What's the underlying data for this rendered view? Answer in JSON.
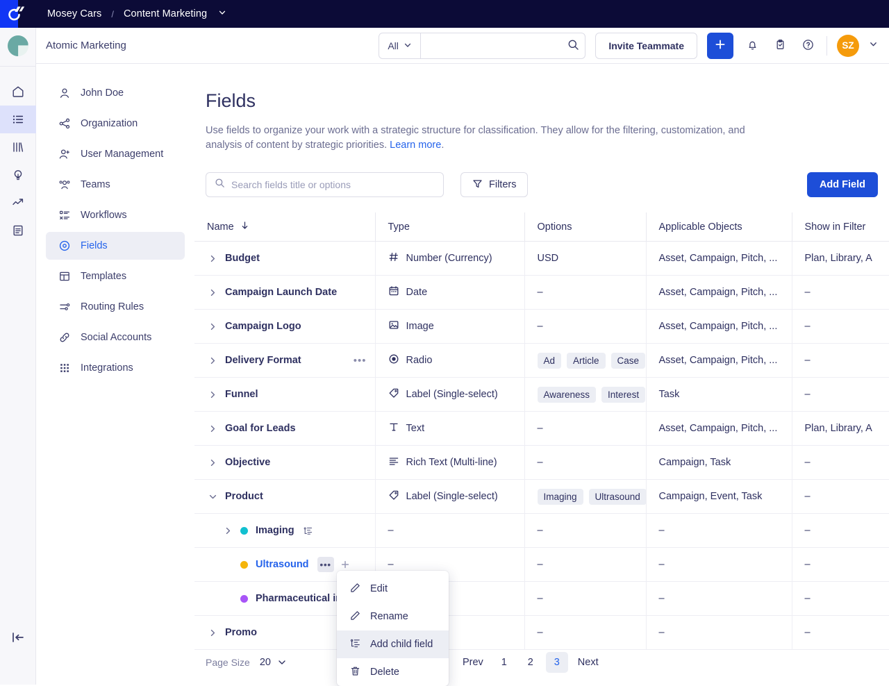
{
  "topbar": {
    "logo_icon": "mosey-logo-icon",
    "breadcrumb_workspace": "Mosey Cars",
    "breadcrumb_separator": "/",
    "breadcrumb_space": "Content Marketing",
    "breadcrumb_caret_icon": "chevron-down-icon"
  },
  "header": {
    "org_name": "Atomic Marketing",
    "search_scope": "All",
    "search_value": "",
    "search_placeholder": "",
    "search_icon": "search-icon",
    "invite_label": "Invite Teammate",
    "plus_icon": "plus-icon",
    "bell_icon": "bell-icon",
    "clipboard_icon": "clipboard-check-icon",
    "help_icon": "question-circle-icon",
    "avatar_initials": "SZ",
    "avatar_caret_icon": "chevron-down-icon",
    "avatar_color": "#f59b0b",
    "accent_color": "#1d4ed8"
  },
  "rail": {
    "brand_avatar": "workspace-avatar",
    "items": [
      {
        "icon": "home-icon",
        "name": "rail-item-home",
        "active": false
      },
      {
        "icon": "list-icon",
        "name": "rail-item-list",
        "active": true
      },
      {
        "icon": "columns-icon",
        "name": "rail-item-columns",
        "active": false
      },
      {
        "icon": "lightbulb-icon",
        "name": "rail-item-ideas",
        "active": false
      },
      {
        "icon": "trend-up-icon",
        "name": "rail-item-analytics",
        "active": false
      },
      {
        "icon": "document-icon",
        "name": "rail-item-reports",
        "active": false
      }
    ],
    "collapse_icon": "collapse-sidebar-icon"
  },
  "sidebar": {
    "items": [
      {
        "label": "John Doe",
        "icon": "user-icon",
        "active": false
      },
      {
        "label": "Organization",
        "icon": "share-nodes-icon",
        "active": false
      },
      {
        "label": "User Management",
        "icon": "user-plus-icon",
        "active": false
      },
      {
        "label": "Teams",
        "icon": "users-group-icon",
        "active": false
      },
      {
        "label": "Workflows",
        "icon": "workflow-icon",
        "active": false
      },
      {
        "label": "Fields",
        "icon": "target-circle-icon",
        "active": true
      },
      {
        "label": "Templates",
        "icon": "layout-icon",
        "active": false
      },
      {
        "label": "Routing Rules",
        "icon": "sliders-icon",
        "active": false
      },
      {
        "label": "Social Accounts",
        "icon": "link-icon",
        "active": false
      },
      {
        "label": "Integrations",
        "icon": "grid-dots-icon",
        "active": false
      }
    ]
  },
  "page": {
    "title": "Fields",
    "description_part1": "Use fields to organize your work with a strategic structure for classification. They allow for the filtering, customization, and analysis of content by strategic priorities. ",
    "description_link": "Learn more",
    "description_part2": "."
  },
  "toolbar": {
    "search_placeholder": "Search fields title or options",
    "search_value": "",
    "search_icon": "search-icon",
    "filters_label": "Filters",
    "filters_icon": "funnel-icon",
    "add_field_label": "Add Field"
  },
  "table": {
    "columns": [
      {
        "label": "Name",
        "sort_icon": "arrow-down-icon"
      },
      {
        "label": "Type"
      },
      {
        "label": "Options"
      },
      {
        "label": "Applicable Objects"
      },
      {
        "label": "Show in Filter"
      }
    ],
    "rows": [
      {
        "kind": "parent",
        "expanded": false,
        "name": "Budget",
        "type_icon": "hash-icon",
        "type": "Number (Currency)",
        "options_text": "USD",
        "chips": [],
        "objects": "Asset, Campaign, Pitch, ...",
        "filter": "Plan, Library, A",
        "show_dots": false
      },
      {
        "kind": "parent",
        "expanded": false,
        "name": "Campaign Launch Date",
        "type_icon": "calendar-icon",
        "type": "Date",
        "options_text": "–",
        "chips": [],
        "objects": "Asset, Campaign, Pitch, ...",
        "filter": "–",
        "show_dots": false
      },
      {
        "kind": "parent",
        "expanded": false,
        "name": "Campaign Logo",
        "type_icon": "image-icon",
        "type": "Image",
        "options_text": "–",
        "chips": [],
        "objects": "Asset, Campaign, Pitch, ...",
        "filter": "–",
        "show_dots": false
      },
      {
        "kind": "parent",
        "expanded": false,
        "name": "Delivery Format",
        "type_icon": "radio-icon",
        "type": "Radio",
        "options_text": "",
        "chips": [
          "Ad",
          "Article",
          "Case"
        ],
        "objects": "Asset, Campaign, Pitch, ...",
        "filter": "–",
        "show_dots": true
      },
      {
        "kind": "parent",
        "expanded": false,
        "name": "Funnel",
        "type_icon": "tag-icon",
        "type": "Label (Single-select)",
        "options_text": "",
        "chips": [
          "Awareness",
          "Interest"
        ],
        "objects": "Task",
        "filter": "–",
        "show_dots": false
      },
      {
        "kind": "parent",
        "expanded": false,
        "name": "Goal for Leads",
        "type_icon": "text-icon",
        "type": "Text",
        "options_text": "–",
        "chips": [],
        "objects": "Asset, Campaign, Pitch, ...",
        "filter": "Plan, Library, A",
        "show_dots": false
      },
      {
        "kind": "parent",
        "expanded": false,
        "name": "Objective",
        "type_icon": "rich-text-icon",
        "type": "Rich Text (Multi-line)",
        "options_text": "–",
        "chips": [],
        "objects": "Campaign, Task",
        "filter": "–",
        "show_dots": false
      },
      {
        "kind": "parent",
        "expanded": true,
        "name": "Product",
        "type_icon": "tag-icon",
        "type": "Label (Single-select)",
        "options_text": "",
        "chips": [
          "Imaging",
          "Ultrasound"
        ],
        "objects": "Campaign, Event, Task",
        "filter": "–",
        "show_dots": false
      },
      {
        "kind": "child",
        "expandable": true,
        "name": "Imaging",
        "dot_color": "#11c0d0",
        "selected": false,
        "has_tree_icon": true,
        "type": "–",
        "options_text": "–",
        "objects": "–",
        "filter": "–"
      },
      {
        "kind": "child",
        "expandable": false,
        "name": "Ultrasound",
        "dot_color": "#f5b50a",
        "selected": true,
        "has_tree_icon": false,
        "drag_handle": true,
        "actions": [
          "more-icon",
          "plus-icon"
        ],
        "type": "–",
        "options_text": "–",
        "objects": "–",
        "filter": "–"
      },
      {
        "kind": "child",
        "expandable": false,
        "name": "Pharmaceutical in",
        "dot_color": "#a855f7",
        "selected": false,
        "has_tree_icon": false,
        "type": "–",
        "options_text": "–",
        "objects": "–",
        "filter": "–"
      },
      {
        "kind": "parent",
        "expanded": false,
        "name": "Promo",
        "type_icon": "",
        "type": "",
        "options_text": "–",
        "chips": [],
        "objects": "–",
        "filter": "–",
        "show_dots": false
      }
    ]
  },
  "context_menu": {
    "items": [
      {
        "label": "Edit",
        "icon": "pencil-icon",
        "highlighted": false
      },
      {
        "label": "Rename",
        "icon": "pencil-icon",
        "highlighted": false
      },
      {
        "label": "Add child field",
        "icon": "tree-child-icon",
        "highlighted": true
      },
      {
        "label": "Delete",
        "icon": "trash-icon",
        "highlighted": false
      }
    ]
  },
  "pagination": {
    "page_size_label": "Page Size",
    "page_size_value": "20",
    "caret_icon": "chevron-down-icon",
    "prev_label": "Prev",
    "pages": [
      "1",
      "2",
      "3"
    ],
    "current_page": "3",
    "next_label": "Next"
  }
}
